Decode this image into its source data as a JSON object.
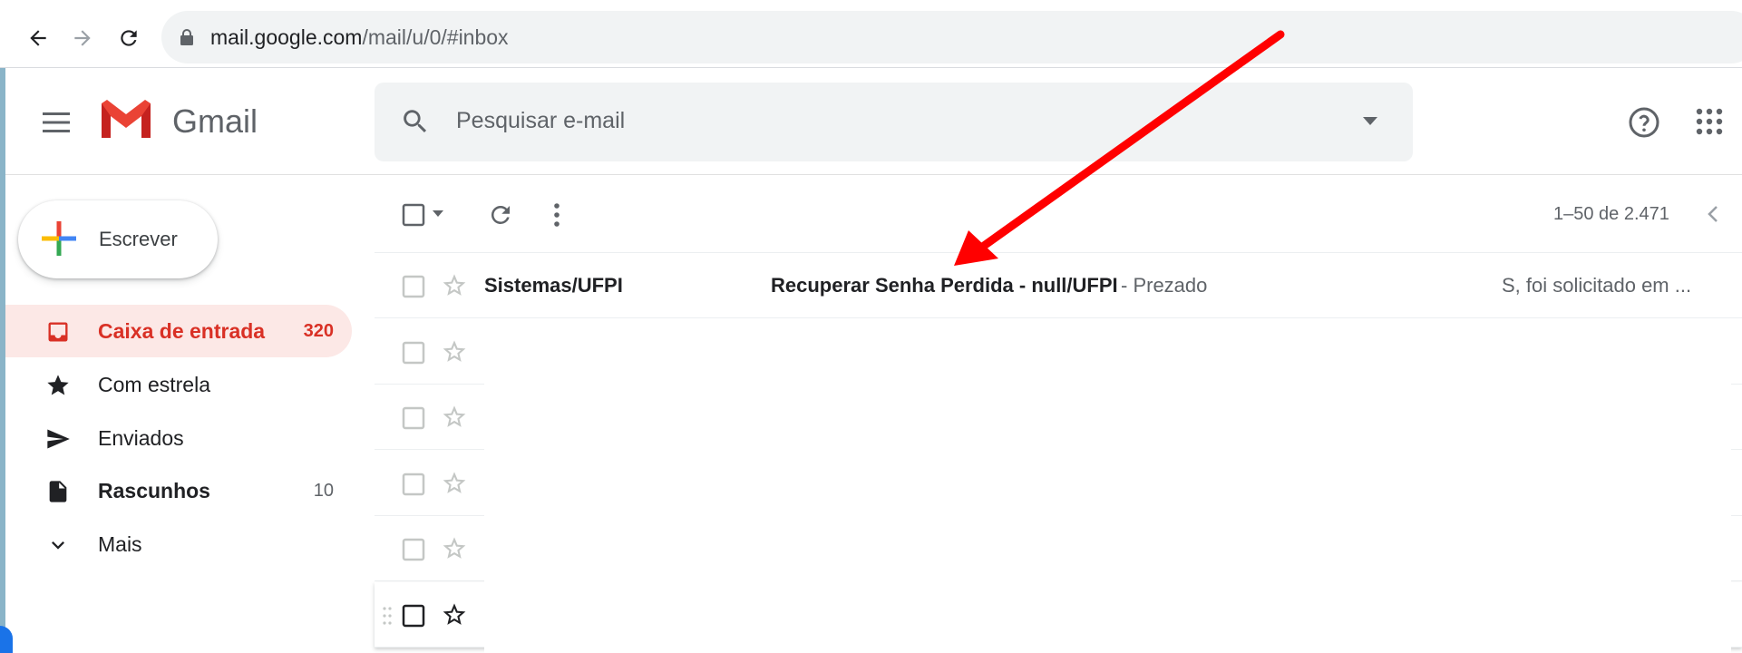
{
  "browser": {
    "url_host": "mail.google.com",
    "url_path": "/mail/u/0/#inbox"
  },
  "header": {
    "brand": "Gmail",
    "search_placeholder": "Pesquisar e-mail"
  },
  "sidebar": {
    "compose_label": "Escrever",
    "items": [
      {
        "label": "Caixa de entrada",
        "count": "320",
        "icon": "inbox-icon",
        "active": true
      },
      {
        "label": "Com estrela",
        "count": "",
        "icon": "star-icon"
      },
      {
        "label": "Enviados",
        "count": "",
        "icon": "send-icon"
      },
      {
        "label": "Rascunhos",
        "count": "10",
        "icon": "draft-icon"
      },
      {
        "label": "Mais",
        "count": "",
        "icon": "chevron-down-icon"
      }
    ]
  },
  "toolbar": {
    "pagination": "1–50 de 2.471"
  },
  "messages": [
    {
      "sender": "Sistemas/UFPI",
      "subject": "Recuperar Senha Perdida - null/UFPI",
      "snippet_start": " - Prezado ",
      "snippet_end": "S, foi solicitado em ..."
    }
  ],
  "colors": {
    "accent": "#d93025",
    "annotation_arrow": "#ff0000"
  }
}
